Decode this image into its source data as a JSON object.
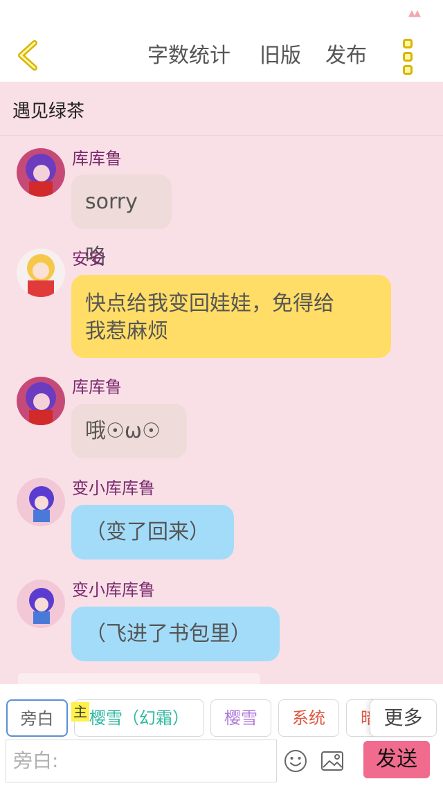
{
  "topbar": {
    "word_count": "字数统计",
    "old_version": "旧版",
    "publish": "发布"
  },
  "chat": {
    "title": "遇见绿茶",
    "messages": [
      {
        "name": "库库鲁",
        "text": "sorry咯",
        "bubble_color": "#efdbd9"
      },
      {
        "name": "安安",
        "line1": "快点给我变回娃娃，免得给",
        "line2": "我惹麻烦",
        "bubble_color": "#ffdd66"
      },
      {
        "name": "库库鲁",
        "text": "哦☉ω☉",
        "bubble_color": "#efdbd9"
      },
      {
        "name": "变小库库鲁",
        "text": "（变了回来）",
        "bubble_color": "#a3dcf9"
      },
      {
        "name": "变小库库鲁",
        "text": "（飞进了书包里）",
        "bubble_color": "#a3dcf9"
      }
    ]
  },
  "characters": {
    "items": [
      {
        "label": "旁白",
        "color": "#666666",
        "selected": true
      },
      {
        "label": "樱雪（幻霜）",
        "color": "#2fb8a0",
        "badge": "主"
      },
      {
        "label": "樱雪",
        "color": "#b07ad8"
      },
      {
        "label": "系统",
        "color": "#e05540"
      },
      {
        "label": "暗",
        "color": "#e05540"
      }
    ],
    "more": "更多"
  },
  "composer": {
    "placeholder": "旁白:",
    "emoji_icon": "smiley-icon",
    "image_icon": "image-icon",
    "send": "发送"
  }
}
